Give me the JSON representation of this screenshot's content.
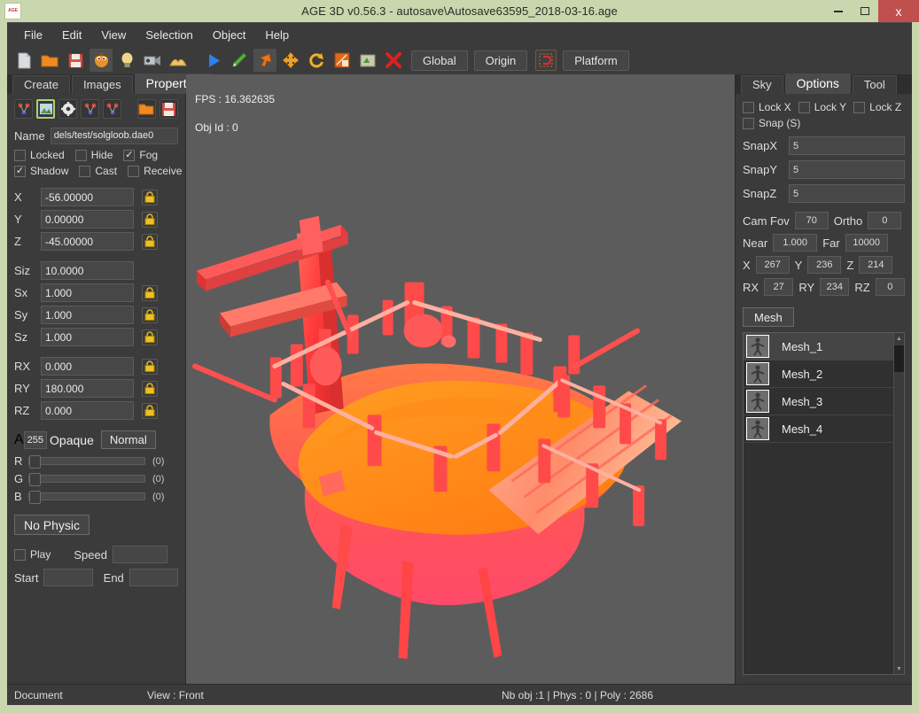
{
  "window": {
    "title": "AGE 3D v0.56.3 - autosave\\Autosave63595_2018-03-16.age",
    "app_icon_text": "AGE",
    "minimize_label": "Minimize",
    "maximize_label": "Maximize",
    "close_label": "x",
    "chrome_color": "#c9d6ae",
    "close_color": "#c0504d"
  },
  "menu": {
    "items": [
      {
        "label": "File"
      },
      {
        "label": "Edit"
      },
      {
        "label": "View"
      },
      {
        "label": "Selection"
      },
      {
        "label": "Object"
      },
      {
        "label": "Help"
      }
    ]
  },
  "toolbar": {
    "icons": [
      {
        "name": "new-document-icon",
        "glyph": "page"
      },
      {
        "name": "open-folder-icon",
        "glyph": "folder"
      },
      {
        "name": "save-floppy-icon",
        "glyph": "floppy"
      },
      {
        "name": "character-icon",
        "glyph": "head"
      },
      {
        "name": "light-bulb-icon",
        "glyph": "bulb"
      },
      {
        "name": "camera-icon",
        "glyph": "camera"
      },
      {
        "name": "terrain-icon",
        "glyph": "terrain"
      },
      {
        "name": "play-icon",
        "glyph": "play"
      },
      {
        "name": "pencil-icon",
        "glyph": "pencil"
      },
      {
        "name": "select-arrow-icon",
        "glyph": "arrow"
      },
      {
        "name": "move-icon",
        "glyph": "move"
      },
      {
        "name": "rotate-icon",
        "glyph": "rotate"
      },
      {
        "name": "scale-icon",
        "glyph": "scale"
      },
      {
        "name": "clone-icon",
        "glyph": "clone"
      },
      {
        "name": "delete-icon",
        "glyph": "cross"
      }
    ],
    "global_label": "Global",
    "origin_label": "Origin",
    "pivot_icon": "pivot-icon",
    "platform_label": "Platform"
  },
  "left_panel": {
    "tabs": [
      {
        "label": "Create",
        "selected": false
      },
      {
        "label": "Images",
        "selected": false
      },
      {
        "label": "Properties",
        "selected": true
      }
    ],
    "prop_icons": [
      {
        "name": "node-icon-1",
        "selected": false
      },
      {
        "name": "texture-image-icon",
        "selected": true
      },
      {
        "name": "gear-settings-icon",
        "selected": false
      },
      {
        "name": "node-icon-2",
        "selected": false
      },
      {
        "name": "node-icon-3",
        "selected": false
      },
      {
        "name": "open-folder-icon",
        "selected": false
      },
      {
        "name": "save-floppy-icon",
        "selected": false
      }
    ],
    "name_label": "Name",
    "name_value": "dels/test/solgloob.dae0",
    "checkboxes_row1": [
      {
        "label": "Locked",
        "checked": false
      },
      {
        "label": "Hide",
        "checked": false
      },
      {
        "label": "Fog",
        "checked": true
      }
    ],
    "checkboxes_row2": [
      {
        "label": "Shadow",
        "checked": true
      },
      {
        "label": "Cast",
        "checked": false
      },
      {
        "label": "Receive",
        "checked": false
      }
    ],
    "transform_fields": [
      {
        "label": "X",
        "value": "-56.00000",
        "lock": true
      },
      {
        "label": "Y",
        "value": "0.00000",
        "lock": true
      },
      {
        "label": "Z",
        "value": "-45.00000",
        "lock": true
      }
    ],
    "size_field": {
      "label": "Siz",
      "value": "10.0000",
      "lock": false
    },
    "scale_fields": [
      {
        "label": "Sx",
        "value": "1.000",
        "lock": true
      },
      {
        "label": "Sy",
        "value": "1.000",
        "lock": true
      },
      {
        "label": "Sz",
        "value": "1.000",
        "lock": true
      }
    ],
    "rotation_fields": [
      {
        "label": "RX",
        "value": "0.000",
        "lock": true
      },
      {
        "label": "RY",
        "value": "180.000",
        "lock": true
      },
      {
        "label": "RZ",
        "value": "0.000",
        "lock": true
      }
    ],
    "alpha": {
      "label": "A",
      "value": "255",
      "mode_label": "Opaque",
      "blend_label": "Normal"
    },
    "color_sliders": [
      {
        "label": "R",
        "value": "(0)",
        "percent": 0
      },
      {
        "label": "G",
        "value": "(0)",
        "percent": 0
      },
      {
        "label": "B",
        "value": "(0)",
        "percent": 0
      }
    ],
    "physic_button": "No Physic",
    "animation": {
      "play_label": "Play",
      "play_checked": false,
      "speed_label": "Speed",
      "speed_value": "",
      "start_label": "Start",
      "start_value": "",
      "end_label": "End",
      "end_value": ""
    }
  },
  "viewport": {
    "fps_text": "FPS : 16.362635",
    "objid_text": "Obj Id : 0",
    "background_color": "#5c5c5c",
    "model_primary_color": "#ff4040",
    "model_secondary_color": "#ff8c1a"
  },
  "right_panel": {
    "tabs": [
      {
        "label": "Sky",
        "selected": false
      },
      {
        "label": "Options",
        "selected": true
      },
      {
        "label": "Tool",
        "selected": false
      }
    ],
    "locks": [
      {
        "label": "Lock X",
        "checked": false
      },
      {
        "label": "Lock Y",
        "checked": false
      },
      {
        "label": "Lock Z",
        "checked": false
      }
    ],
    "snap_toggle": {
      "label": "Snap (S)",
      "checked": false
    },
    "snap_fields": [
      {
        "label": "SnapX",
        "value": "5"
      },
      {
        "label": "SnapY",
        "value": "5"
      },
      {
        "label": "SnapZ",
        "value": "5"
      }
    ],
    "camera": {
      "fov_label": "Cam Fov",
      "fov_value": "70",
      "ortho_label": "Ortho",
      "ortho_value": "0",
      "near_label": "Near",
      "near_value": "1.000",
      "far_label": "Far",
      "far_value": "10000",
      "pos": [
        {
          "label": "X",
          "value": "267"
        },
        {
          "label": "Y",
          "value": "236"
        },
        {
          "label": "Z",
          "value": "214"
        }
      ],
      "rot": [
        {
          "label": "RX",
          "value": "27"
        },
        {
          "label": "RY",
          "value": "234"
        },
        {
          "label": "RZ",
          "value": "0"
        }
      ]
    },
    "mesh_button": "Mesh",
    "mesh_list": [
      {
        "label": "Mesh_1",
        "selected": true
      },
      {
        "label": "Mesh_2",
        "selected": false
      },
      {
        "label": "Mesh_3",
        "selected": false
      },
      {
        "label": "Mesh_4",
        "selected": false
      }
    ]
  },
  "status_bar": {
    "document": "Document",
    "view": "View : Front",
    "stats": "Nb obj :1 | Phys : 0 | Poly : 2686"
  }
}
